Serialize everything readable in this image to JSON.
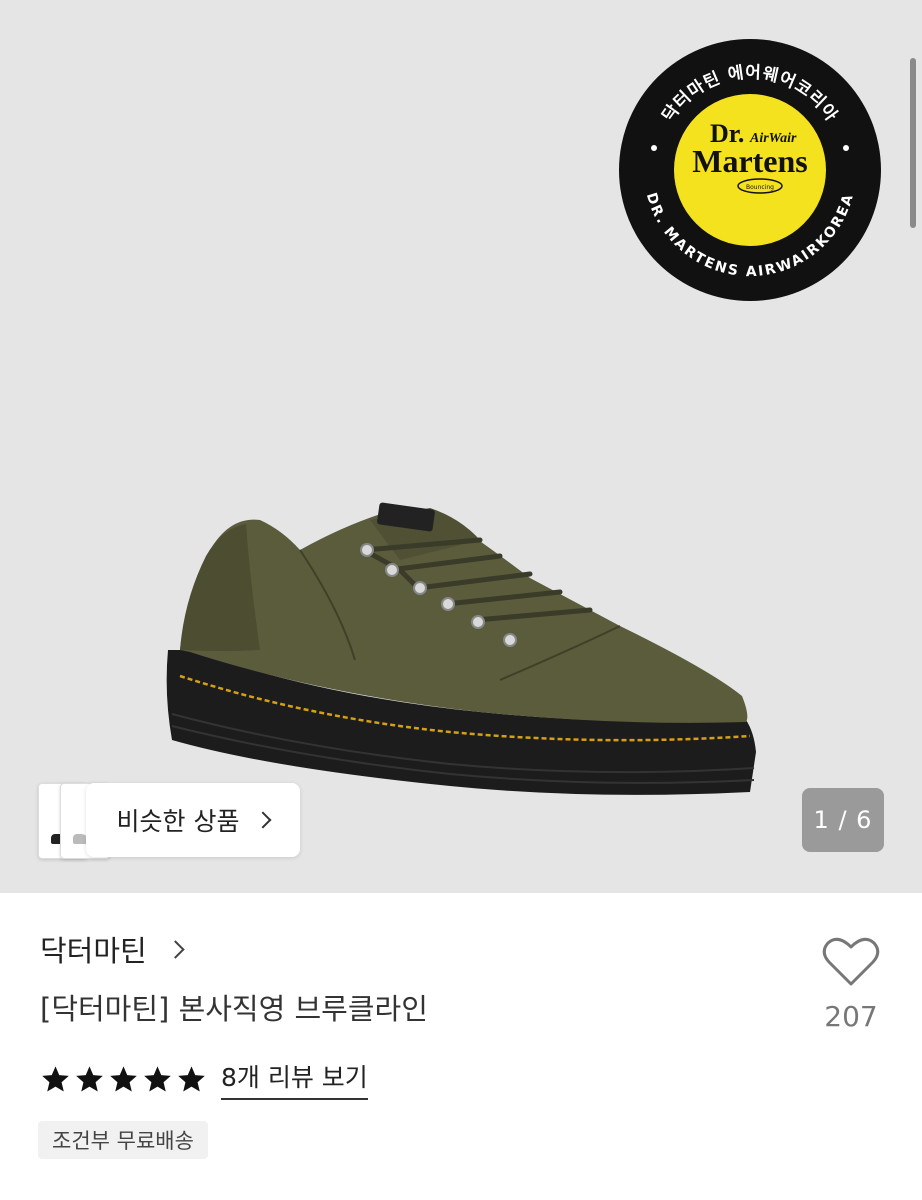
{
  "gallery": {
    "counter": "1 / 6",
    "similar_label": "비슷한 상품",
    "badge": {
      "top_text": "닥터마틴 에어웨어코리아",
      "bottom_text": "DR. MARTENS AIRWAIRKOREA",
      "logo_line1": "Dr.",
      "logo_line2": "AirWair",
      "logo_line3": "Martens",
      "logo_line4": "Bouncing"
    }
  },
  "product": {
    "brand": "닥터마틴",
    "title": "[닥터마틴] 본사직영 브루클라인",
    "likes": "207",
    "rating_stars": 5,
    "review_link": "8개 리뷰 보기",
    "shipping_tag": "조건부 무료배송"
  },
  "colors": {
    "hero_bg": "#e5e5e6",
    "shoe_olive": "#5b5c3c",
    "sole": "#1c1c1c",
    "stitch": "#d4a015",
    "badge_yellow": "#f5e21f"
  },
  "icons": [
    "heart-icon",
    "star-icon",
    "chevron-right-icon"
  ]
}
